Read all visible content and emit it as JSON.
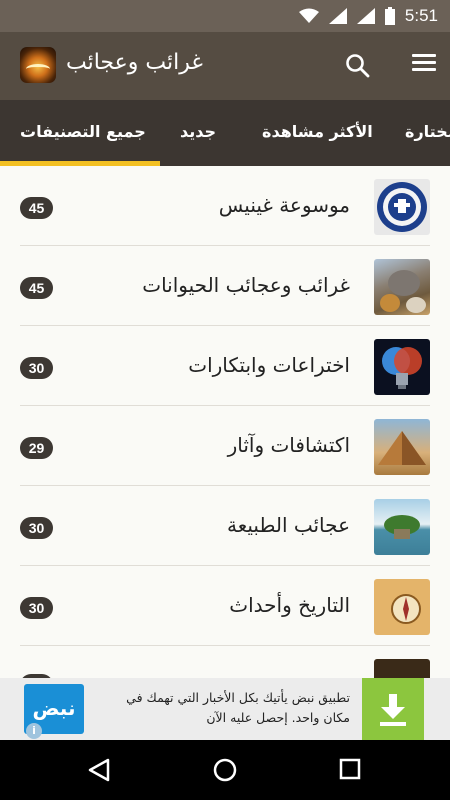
{
  "status_bar": {
    "time": "5:51"
  },
  "app_bar": {
    "title": "غرائب وعجائب"
  },
  "tabs": [
    {
      "label": "جميع التصنيفات",
      "active": true
    },
    {
      "label": "جديد",
      "active": false
    },
    {
      "label": "الأكثر مشاهدة",
      "active": false
    },
    {
      "label": "مختارة",
      "active": false
    }
  ],
  "categories": [
    {
      "label": "موسوعة غينيس",
      "count": "45",
      "thumb": "guinness-world-records"
    },
    {
      "label": "غرائب وعجائب الحيوانات",
      "count": "45",
      "thumb": "animals"
    },
    {
      "label": "اختراعات وابتكارات",
      "count": "30",
      "thumb": "lightbulb-brain"
    },
    {
      "label": "اكتشافات وآثار",
      "count": "29",
      "thumb": "pyramid"
    },
    {
      "label": "عجائب الطبيعة",
      "count": "30",
      "thumb": "island"
    },
    {
      "label": "التاريخ وأحداث",
      "count": "30",
      "thumb": "old-map-compass"
    }
  ],
  "ad": {
    "logo_text": "نبض",
    "text": "تطبيق نبض يأتيك بكل الأخبار التي تهمك في مكان واحد. إحصل عليه الآن",
    "info_label": "i"
  },
  "colors": {
    "status_bar": "#6b6157",
    "app_bar": "#554c42",
    "tabs_bg": "#3c3631",
    "tab_indicator": "#f3c022",
    "badge": "#3d3833",
    "ad_download": "#8cc63e",
    "ad_logo": "#1a8fd6"
  }
}
